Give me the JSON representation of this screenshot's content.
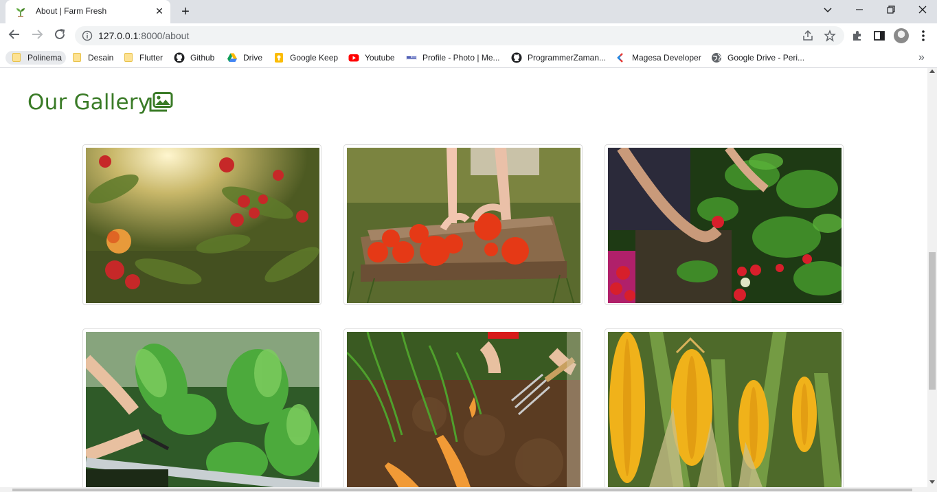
{
  "browser": {
    "tab_title": "About | Farm Fresh",
    "url_host": "127.0.0.1",
    "url_path": ":8000/about",
    "bookmarks": [
      {
        "label": "Polinema",
        "icon": "folder-icon"
      },
      {
        "label": "Desain",
        "icon": "folder-icon"
      },
      {
        "label": "Flutter",
        "icon": "folder-icon"
      },
      {
        "label": "Github",
        "icon": "github-icon"
      },
      {
        "label": "Drive",
        "icon": "google-drive-icon"
      },
      {
        "label": "Google Keep",
        "icon": "google-keep-icon"
      },
      {
        "label": "Youtube",
        "icon": "youtube-icon"
      },
      {
        "label": "Profile - Photo | Me...",
        "icon": "profile-site-icon"
      },
      {
        "label": "ProgrammerZaman...",
        "icon": "github-icon"
      },
      {
        "label": "Magesa Developer",
        "icon": "magesa-icon"
      },
      {
        "label": "Google Drive - Peri...",
        "icon": "globe-icon"
      }
    ],
    "more_bookmarks_glyph": "»"
  },
  "page": {
    "gallery_title": "Our Gallery",
    "gallery_icon": "images-icon",
    "accent_color": "#3a7b27",
    "gallery": [
      {
        "subject": "apples"
      },
      {
        "subject": "tomatoes"
      },
      {
        "subject": "strawberries"
      },
      {
        "subject": "lettuce"
      },
      {
        "subject": "carrots"
      },
      {
        "subject": "corn"
      }
    ]
  }
}
